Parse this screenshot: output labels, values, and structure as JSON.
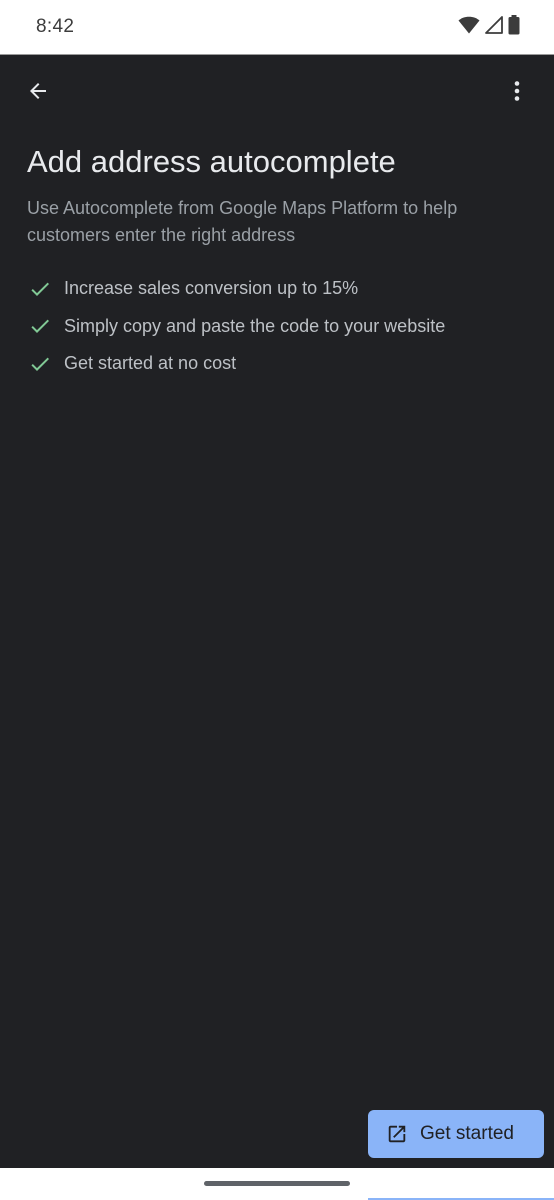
{
  "status_bar": {
    "time": "8:42",
    "icons": [
      "wifi-icon",
      "cell-signal-icon",
      "battery-icon"
    ]
  },
  "app_bar": {
    "back_icon": "arrow-back-icon",
    "menu_icon": "more-vert-icon"
  },
  "main": {
    "title": "Add address autocomplete",
    "subtitle": "Use Autocomplete from Google Maps Platform to help customers enter the right address",
    "features": [
      {
        "icon": "check-icon",
        "text": "Increase sales conversion up to 15%"
      },
      {
        "icon": "check-icon",
        "text": "Simply copy and paste the code to your website"
      },
      {
        "icon": "check-icon",
        "text": "Get started at no cost"
      }
    ]
  },
  "cta": {
    "icon": "open-in-new-icon",
    "label": "Get started"
  },
  "colors": {
    "background": "#202124",
    "title": "#e8eaed",
    "subtitle": "#9aa0a6",
    "check": "#81c995",
    "button": "#8ab4f8",
    "button_text": "#202124"
  }
}
